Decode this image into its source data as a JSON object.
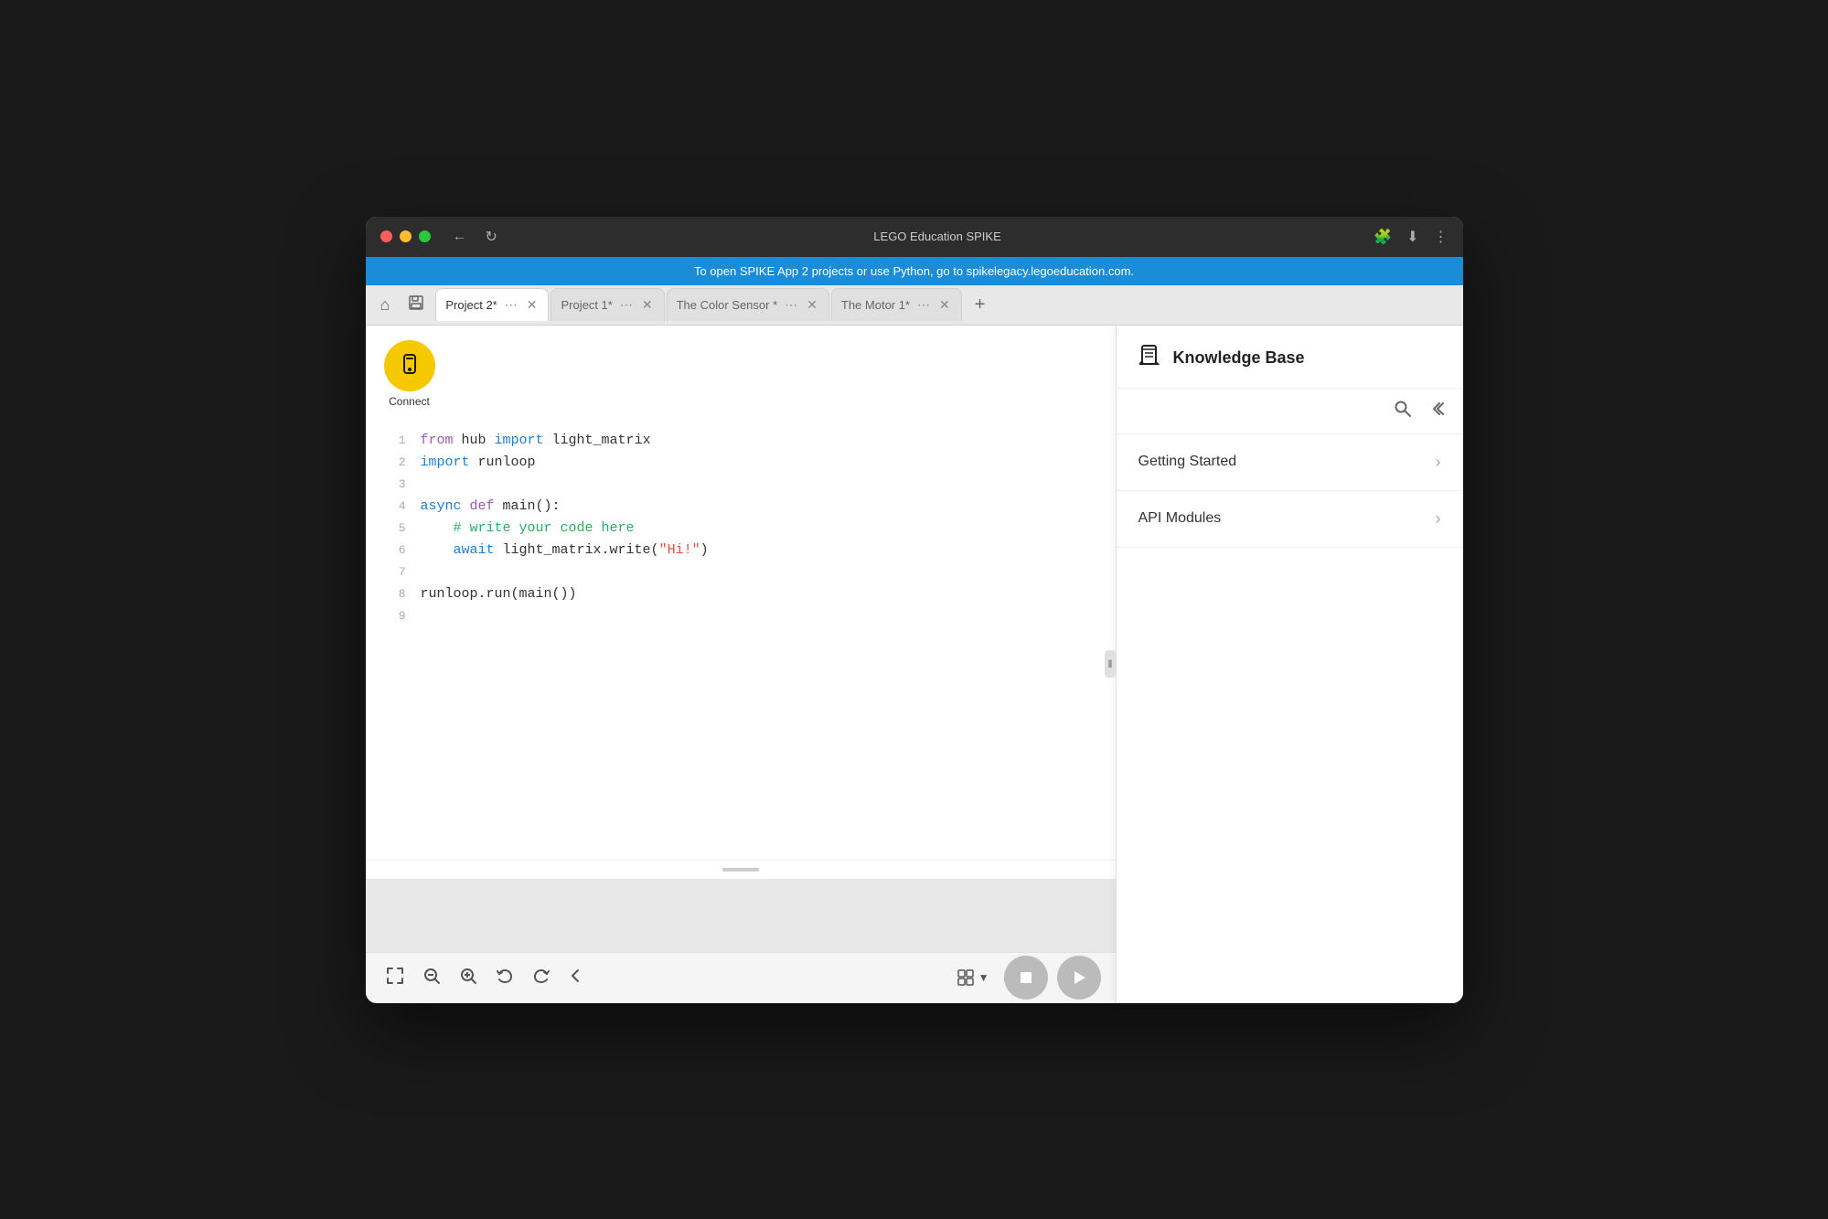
{
  "titlebar": {
    "title": "LEGO Education SPIKE",
    "nav_back": "←",
    "nav_reload": "↻",
    "action_puzzle": "🧩",
    "action_download": "⬇",
    "action_menu": "⋮"
  },
  "infobar": {
    "message": "To open SPIKE App 2 projects or use Python, go to spikelegacy.legoeducation.com."
  },
  "tabs": [
    {
      "label": "Project 2*",
      "active": true
    },
    {
      "label": "Project 1*",
      "active": false
    },
    {
      "label": "The Color Sensor *",
      "active": false
    },
    {
      "label": "The Motor 1*",
      "active": false
    }
  ],
  "editor": {
    "connect_label": "Connect",
    "lines": [
      {
        "num": "1",
        "content": "from hub import light_matrix"
      },
      {
        "num": "2",
        "content": "import runloop"
      },
      {
        "num": "3",
        "content": ""
      },
      {
        "num": "4",
        "content": "async def main():"
      },
      {
        "num": "5",
        "content": "    # write your code here"
      },
      {
        "num": "6",
        "content": "    await light_matrix.write(\"Hi!\")"
      },
      {
        "num": "7",
        "content": ""
      },
      {
        "num": "8",
        "content": "runloop.run(main())"
      },
      {
        "num": "9",
        "content": ""
      }
    ]
  },
  "knowledge_base": {
    "title": "Knowledge Base",
    "items": [
      {
        "label": "Getting Started"
      },
      {
        "label": "API Modules"
      }
    ]
  },
  "toolbar": {
    "fullscreen": "⛶",
    "zoom_out": "−",
    "zoom_in": "+",
    "undo": "↩",
    "redo": "↪",
    "collapse": "‹"
  }
}
